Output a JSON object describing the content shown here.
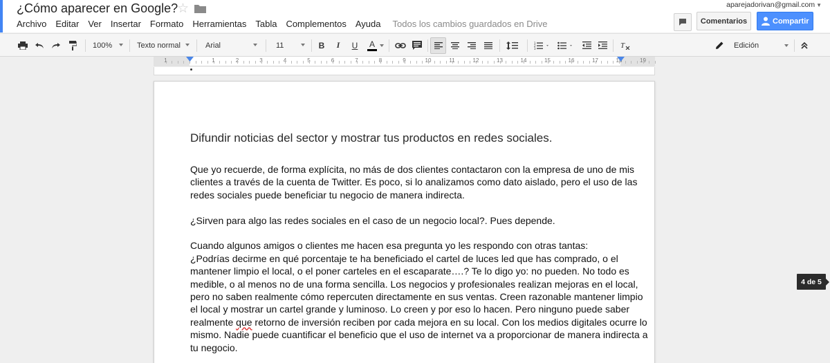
{
  "header": {
    "title": "¿Cómo aparecer en Google?",
    "user_email": "aparejadorivan@gmail.com",
    "comments_label": "Comentarios",
    "share_label": "Compartir",
    "save_status": "Todos los cambios guardados en Drive"
  },
  "menu": {
    "items": [
      "Archivo",
      "Editar",
      "Ver",
      "Insertar",
      "Formato",
      "Herramientas",
      "Tabla",
      "Complementos",
      "Ayuda"
    ]
  },
  "toolbar": {
    "zoom": "100%",
    "style": "Texto normal",
    "font": "Arial",
    "font_size": "11",
    "bold": "B",
    "italic": "I",
    "underline": "U",
    "text_color": "A",
    "mode": "Edición"
  },
  "ruler": {
    "numbers": [
      "1",
      "1",
      "2",
      "3",
      "4",
      "5",
      "6",
      "7",
      "8",
      "9",
      "10",
      "11",
      "12",
      "13",
      "14",
      "15",
      "16",
      "17",
      "18",
      "19"
    ]
  },
  "document": {
    "heading": "Difundir noticias del sector y mostrar tus productos en redes sociales.",
    "p1": [
      "Que yo recuerde, de forma explícita, no más de dos clientes contactaron con la empresa de uno de mis",
      "clientes a través de la cuenta de Twitter. Es poco, si lo analizamos como dato aislado, pero el uso de las",
      "redes sociales puede beneficiar tu negocio de manera indirecta."
    ],
    "p2": "¿Sirven para algo las redes sociales en el caso de un negocio local?. Pues depende.",
    "p3": [
      "Cuando algunos amigos o clientes me hacen esa pregunta yo les respondo con otras tantas:",
      "¿Podrías decirme en qué porcentaje te ha beneficiado el cartel de luces led que has comprado, o el",
      "mantener limpio el local, o el poner carteles en el escaparate….? Te lo digo yo: no pueden. No todo es",
      "medible, o al menos no de una forma sencilla. Los negocios y profesionales realizan  mejoras en el local,",
      "pero no saben realmente cómo repercuten directamente en sus ventas. Creen razonable mantener limpio",
      "el local y mostrar un cartel grande y luminoso. Lo creen y por eso lo hacen. Pero ninguno puede saber"
    ],
    "p3_line7_before": "realmente ",
    "p3_line7_misspelled": "que",
    "p3_line7_after": " retorno de inversión reciben por cada mejora en su local. Con los medios digitales ocurre lo",
    "p3_tail": [
      "mismo. Nadie puede cuantificar el beneficio que el uso de internet va a proporcionar de manera indirecta a",
      "tu negocio."
    ]
  },
  "page_counter": "4 de 5",
  "colors": {
    "accent_blue": "#4285f4",
    "share_blue": "#4d90fe",
    "ruler_marker": "#4a86e8",
    "background": "#efefef"
  }
}
